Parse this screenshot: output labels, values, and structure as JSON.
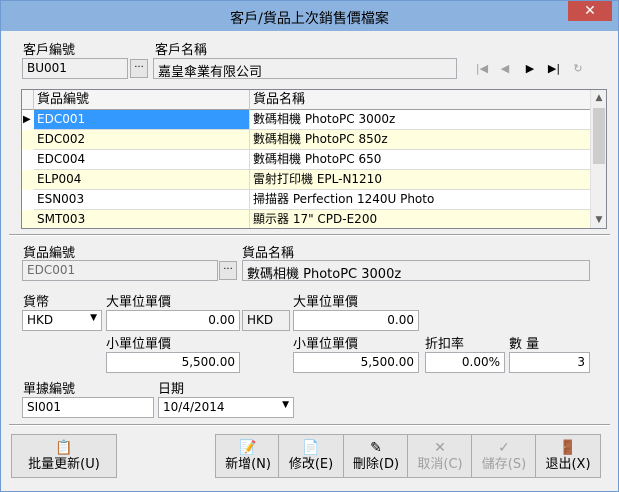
{
  "window": {
    "title": "客戶/貨品上次銷售價檔案",
    "close_label": "✕"
  },
  "customer": {
    "code_label": "客戶編號",
    "name_label": "客戶名稱",
    "code_value": "BU001",
    "name_value": "嘉皇傘業有限公司",
    "lookup_label": "···"
  },
  "navigation": {
    "first": "|◀",
    "prev": "◀",
    "next": "▶",
    "last": "▶|",
    "refresh": "↻"
  },
  "grid": {
    "columns": [
      "貨品編號",
      "貨品名稱"
    ],
    "rows": [
      {
        "code": "EDC001",
        "name": "數碼相機 PhotoPC 3000z"
      },
      {
        "code": "EDC002",
        "name": "數碼相機 PhotoPC 850z"
      },
      {
        "code": "EDC004",
        "name": "數碼相機 PhotoPC 650"
      },
      {
        "code": "ELP004",
        "name": "雷射打印機 EPL-N1210"
      },
      {
        "code": "ESN003",
        "name": "掃描器 Perfection 1240U Photo"
      },
      {
        "code": "SMT003",
        "name": "顯示器 17\" CPD-E200"
      }
    ],
    "selected_index": 0,
    "current_row_marker": "▶"
  },
  "detail": {
    "item_code_label": "貨品編號",
    "item_code_value": "EDC001",
    "item_name_label": "貨品名稱",
    "item_name_value": "數碼相機 PhotoPC 3000z",
    "lookup_label": "···",
    "currency_label": "貨幣",
    "currency_value": "HKD",
    "big_unit_price_label": "大單位單價",
    "big_unit_price_value": "0.00",
    "base_currency": "HKD",
    "big_unit_price2_label": "大單位單價",
    "big_unit_price2_value": "0.00",
    "small_unit_price_label": "小單位單價",
    "small_unit_price_value": "5,500.00",
    "small_unit_price2_label": "小單位單價",
    "small_unit_price2_value": "5,500.00",
    "discount_label": "折扣率",
    "discount_value": "0.00%",
    "qty_label": "數 量",
    "qty_value": "3",
    "doc_no_label": "單據編號",
    "doc_no_value": "SI001",
    "date_label": "日期",
    "date_value": "10/4/2014"
  },
  "toolbar": {
    "batch_update": "批量更新(U)",
    "add": "新增(N)",
    "edit": "修改(E)",
    "delete": "刪除(D)",
    "cancel": "取消(C)",
    "save": "儲存(S)",
    "exit": "退出(X)"
  },
  "colors": {
    "selection": "#3399ff",
    "alt_row": "#ffffe0",
    "titlebar": "#8cb3e0",
    "close": "#c7504a"
  }
}
